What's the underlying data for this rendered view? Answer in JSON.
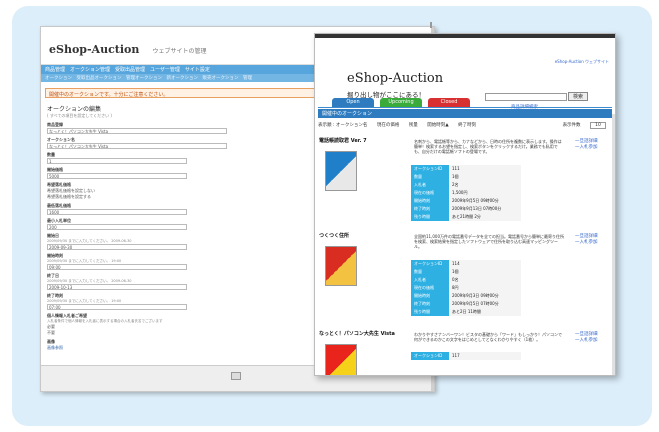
{
  "admin": {
    "logo": "eShop-Auction",
    "subtitle": "ウェブサイトの管理",
    "nav_primary": "商品管理　オークション管理　受取出品管理　ユーザー管理　サイト設定",
    "nav_secondary": "オークション　受取出品オークション　管理オークション　新オークション　販売オークション　管理",
    "alert": "開催中のオークションです。十分にご注意ください。",
    "form_title": "オークションの編集",
    "form_note": "( すべての項目を設定してください )",
    "fields": [
      {
        "label": "商品登録",
        "value": "なっとく！パソコン大先生 Vista"
      },
      {
        "label": "オークション名",
        "value": "なっとく！パソコン大先生 Vista"
      },
      {
        "label": "数量",
        "value": "1"
      },
      {
        "label": "開始価格",
        "value": "5000"
      },
      {
        "label": "希望落札価格",
        "value": "",
        "radios": [
          "希望落札価格を設定しない",
          "希望落札価格を設定する"
        ]
      },
      {
        "label": "最低落札価格",
        "value": "1600"
      },
      {
        "label": "最小入札単位",
        "value": "200"
      },
      {
        "label": "開始日",
        "value": "2009-09-30",
        "hint": "2009/09/30 までに入力してください。 2009-06-30"
      },
      {
        "label": "開始時刻",
        "value": "09:00",
        "hint": "2009/09/30 までに入力してください。 19:00"
      },
      {
        "label": "終了日",
        "value": "2009-10-13",
        "hint": "2009/09/30 までに入力してください。 2009-06-30"
      },
      {
        "label": "終了時刻",
        "value": "07:00",
        "hint": "2009/09/30 までに入力してください。 19:00"
      },
      {
        "label": "個人情報入札者ご希望",
        "value": "",
        "hint": "入札者条件で個人情報を入札者に表示する場合の入札者氏名でございます",
        "radios": [
          "必要",
          "不要"
        ]
      },
      {
        "label": "画像",
        "value": ""
      }
    ],
    "image_link": "画像参照"
  },
  "shop": {
    "top_link": "eShop-Auction ウェブサイト",
    "brand": "eShop-Auction",
    "tagline": "掘り出し物がここにある！",
    "search_button": "検索",
    "advanced_search": "商品詳細検索",
    "tabs": [
      {
        "label": "Open",
        "color": "#2e7bbf"
      },
      {
        "label": "Upcoming",
        "color": "#3aaa3a"
      },
      {
        "label": "Closed",
        "color": "#d83030"
      }
    ],
    "section": "開催中のオークション",
    "sort_label": "表示順 : オークション名",
    "sort_options": [
      "現在の価格",
      "残量",
      "開始時刻▲",
      "終了時刻"
    ],
    "per_page_label": "表示件数",
    "per_page": "10",
    "items": [
      {
        "name": "電話帳読取君 Ver. 7",
        "desc": "名刺から、電話帳等から、カナなどから、日時の住所を複数に表示します。操作は簡単！検索するお望を指定し、検索ボタンをクリックするだけ。業務でも私用でも、自分だけの電話帳ソフトの登場です。",
        "links": [
          "一旦話詳細",
          "一入札参加"
        ],
        "specs": [
          [
            "オークションID",
            "111"
          ],
          [
            "数量",
            "1個"
          ],
          [
            "入札者",
            "2名"
          ],
          [
            "現在の価格",
            "1,500円"
          ],
          [
            "開始時刻",
            "2009年9月5日 09時00分"
          ],
          [
            "終了時刻",
            "2009年9月13日 07時00分"
          ],
          [
            "残り時間",
            "あと21時間 2分"
          ]
        ]
      },
      {
        "name": "つくつく住所",
        "desc": "全国約11,000万件の電話番号データを全ての担当。電話番号から簡単に最寄り住所を検索、検索結果を指定したソフトウェアで住所を取り込む高速マッピングツール。",
        "links": [
          "一旦話詳細",
          "一入札参加"
        ],
        "specs": [
          [
            "オークションID",
            "114"
          ],
          [
            "数量",
            "1個"
          ],
          [
            "入札者",
            "0名"
          ],
          [
            "現在の価格",
            "8円"
          ],
          [
            "開始時刻",
            "2009年9月3日 09時00分"
          ],
          [
            "終了時刻",
            "2009年9月5日 07時00分"
          ],
          [
            "残り時間",
            "あと2日 11時間"
          ]
        ]
      },
      {
        "name": "なっとく！パソコン大先生 Vista",
        "desc": "わかりやすさナンバーワン！ビスタの基礎から「ワード」もしっかり！パソコンで何ができるのかこの文字をはじめとしてとなくわかりやすく（1枚）。",
        "links": [
          "一旦話詳細",
          "一入札参加"
        ],
        "specs": [
          [
            "オークションID",
            "117"
          ]
        ]
      }
    ]
  }
}
